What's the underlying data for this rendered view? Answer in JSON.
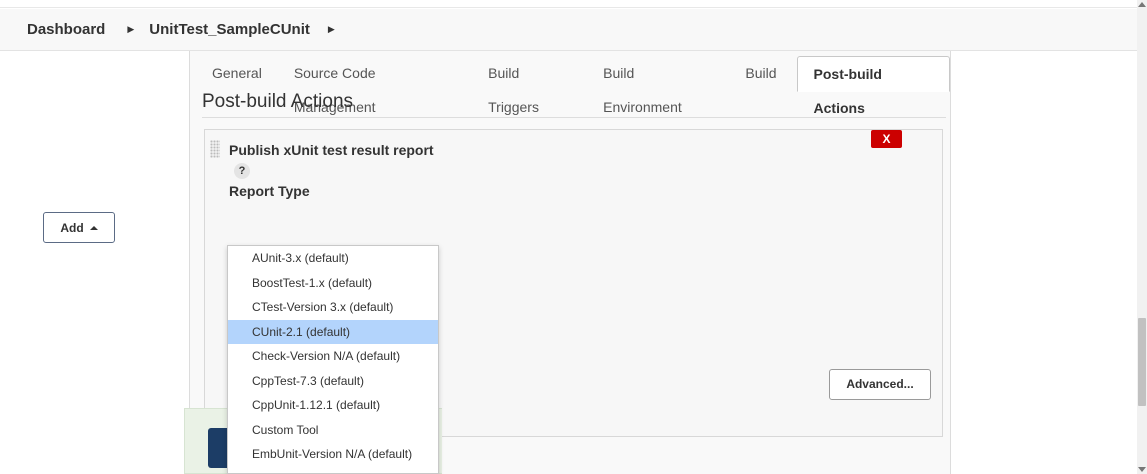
{
  "breadcrumb": {
    "items": [
      "Dashboard",
      "UnitTest_SampleCUnit"
    ]
  },
  "tabs": [
    {
      "label": "General",
      "active": false
    },
    {
      "label": "Source Code Management",
      "active": false
    },
    {
      "label": "Build Triggers",
      "active": false
    },
    {
      "label": "Build Environment",
      "active": false
    },
    {
      "label": "Build",
      "active": false
    },
    {
      "label": "Post-build Actions",
      "active": true
    }
  ],
  "section": {
    "title": "Post-build Actions"
  },
  "action": {
    "title": "Publish xUnit test result report",
    "help": "?",
    "report_type_label": "Report Type",
    "delete_label": "X",
    "advanced_label": "Advanced...",
    "add_label": "Add"
  },
  "dropdown": {
    "items": [
      "AUnit-3.x (default)",
      "BoostTest-1.x (default)",
      "CTest-Version 3.x (default)",
      "CUnit-2.1 (default)",
      "Check-Version N/A (default)",
      "CppTest-7.3 (default)",
      "CppUnit-1.12.1 (default)",
      "Custom Tool",
      "EmbUnit-Version N/A (default)"
    ],
    "highlighted_item": "CUnit-2.1 (default)"
  },
  "colors": {
    "delete_red": "#cc0000",
    "highlight_blue": "#b3d4fc",
    "save_button_blue": "#1c3d66"
  },
  "icons": [
    "breadcrumb-arrow-icon",
    "drag-handle-icon",
    "help-icon",
    "caret-up-icon"
  ]
}
